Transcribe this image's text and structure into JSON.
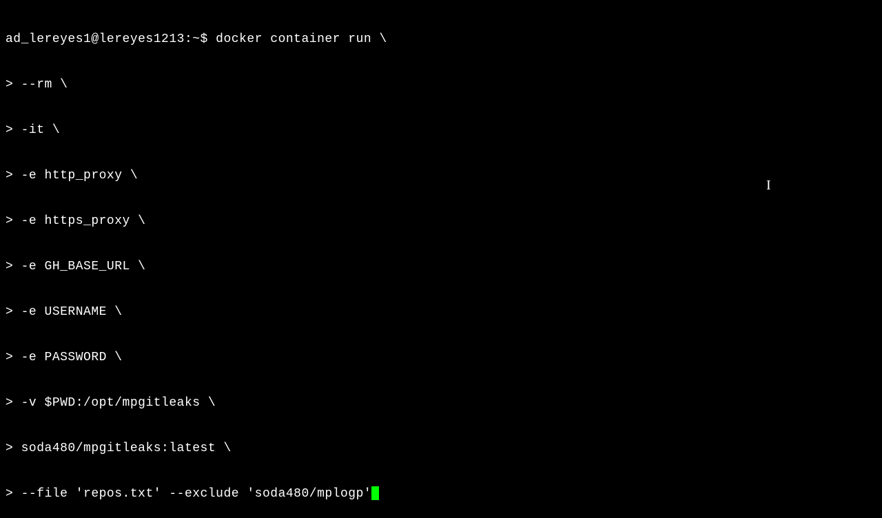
{
  "terminal": {
    "prompt": "ad_lereyes1@lereyes1213:~$ ",
    "continuation": "> ",
    "command_first": "docker container run \\",
    "lines": [
      "--rm \\",
      "-it \\",
      "-e http_proxy \\",
      "-e https_proxy \\",
      "-e GH_BASE_URL \\",
      "-e USERNAME \\",
      "-e PASSWORD \\",
      "-v $PWD:/opt/mpgitleaks \\",
      "soda480/mpgitleaks:latest \\",
      "--file 'repos.txt' --exclude 'soda480/mplogp'"
    ]
  },
  "mouse_cursor_glyph": "I"
}
